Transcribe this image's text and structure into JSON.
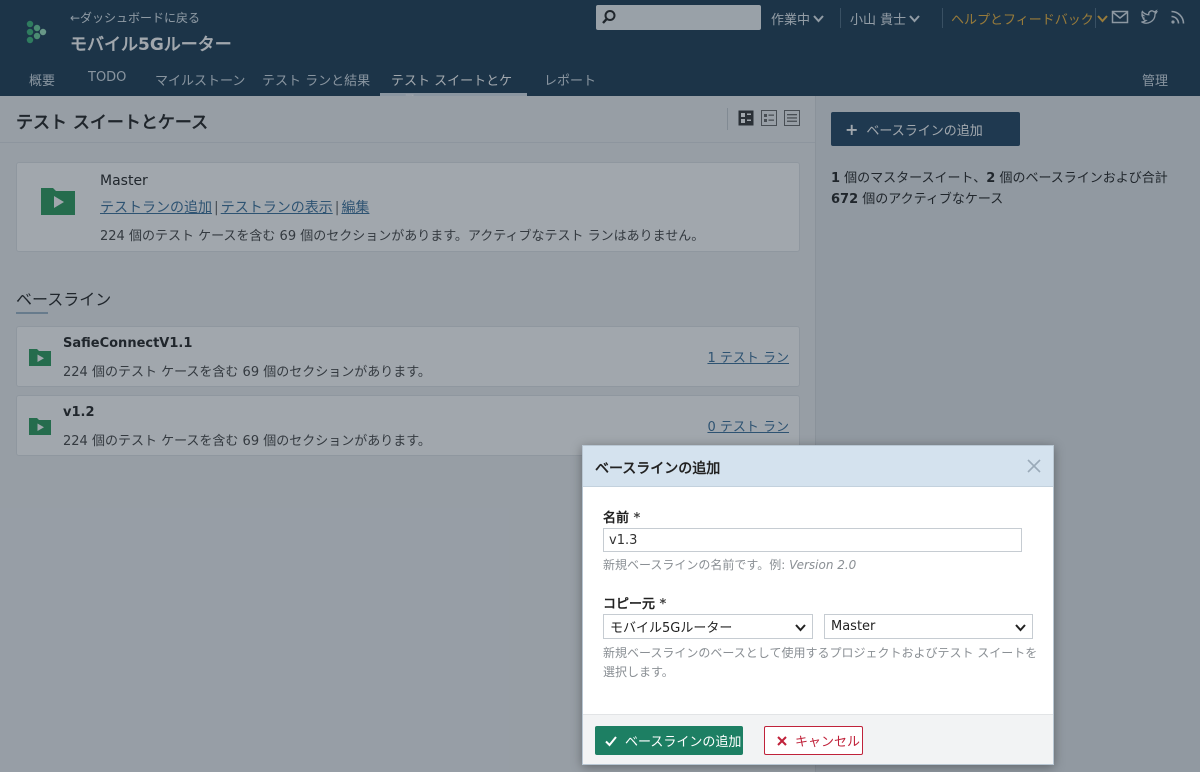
{
  "header": {
    "back_link": "←ダッシュボードに戻る",
    "project_title": "モバイル5Gルーター",
    "search_placeholder": "",
    "menus": {
      "status": "作業中",
      "user": "小山 貴士",
      "help": "ヘルプとフィードバック"
    },
    "icons": [
      "mail-icon",
      "twitter-icon",
      "rss-icon"
    ],
    "tabs": [
      {
        "label": "概要"
      },
      {
        "label": "TODO"
      },
      {
        "label": "マイルストーン"
      },
      {
        "label": "テスト ランと結果"
      },
      {
        "label": "テスト スイートとケース",
        "active": true
      },
      {
        "label": "レポート"
      }
    ],
    "admin_label": "管理"
  },
  "main": {
    "title": "テスト スイートとケース",
    "master": {
      "name": "Master",
      "links": [
        "テストランの追加",
        "テストランの表示",
        "編集"
      ],
      "description": "224 個のテスト ケースを含む 69 個のセクションがあります。アクティブなテスト ランはありません。"
    },
    "baselines_title": "ベースライン",
    "baselines": [
      {
        "name": "SafieConnectV1.1",
        "description": "224 個のテスト ケースを含む 69 個のセクションがあります。",
        "runs": "1 テスト ラン"
      },
      {
        "name": "v1.2",
        "description": "224 個のテスト ケースを含む 69 個のセクションがあります。",
        "runs": "0 テスト ラン"
      }
    ]
  },
  "side": {
    "add_button": "ベースラインの追加",
    "summary_parts": [
      "1",
      " 個のマスタースイート、",
      "2",
      " 個のベースラインおよび合計 ",
      "672",
      " 個のアクティブなケース"
    ]
  },
  "dialog": {
    "title": "ベースラインの追加",
    "name_label": "名前",
    "required_mark": "*",
    "name_value": "v1.3",
    "name_hint": "新規ベースラインの名前です。例: ",
    "name_hint_example": "Version 2.0",
    "copy_label": "コピー元",
    "project_select": "モバイル5Gルーター",
    "suite_select": "Master",
    "copy_hint": "新規ベースラインのベースとして使用するプロジェクトおよびテスト スイートを選択します。",
    "ok_button": "ベースラインの追加",
    "cancel_button": "キャンセル"
  },
  "colors": {
    "header_bg": "#1b3a52",
    "accent_green": "#1d7f63",
    "cancel_red": "#c0223a",
    "help_orange": "#f0b33a",
    "folder_green": "#2a9a5a"
  }
}
